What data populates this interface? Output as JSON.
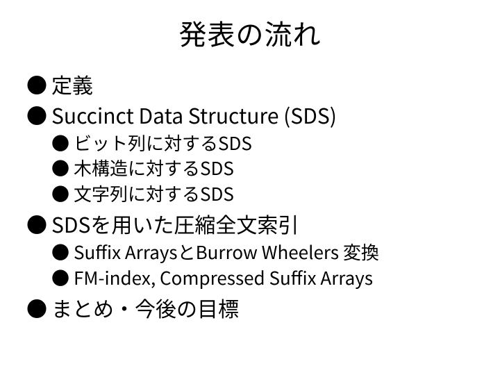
{
  "title": "発表の流れ",
  "items": [
    {
      "text": "定義"
    },
    {
      "text": "Succinct Data Structure (SDS)",
      "children": [
        {
          "text": "ビット列に対するSDS"
        },
        {
          "text": "木構造に対するSDS"
        },
        {
          "text": "文字列に対するSDS"
        }
      ]
    },
    {
      "text": "SDSを用いた圧縮全文索引",
      "children": [
        {
          "text": "Suffix ArraysとBurrow Wheelers 変換"
        },
        {
          "text": "FM-index, Compressed Suffix Arrays"
        }
      ]
    },
    {
      "text": "まとめ・今後の目標"
    }
  ],
  "bullet_glyph": "●"
}
